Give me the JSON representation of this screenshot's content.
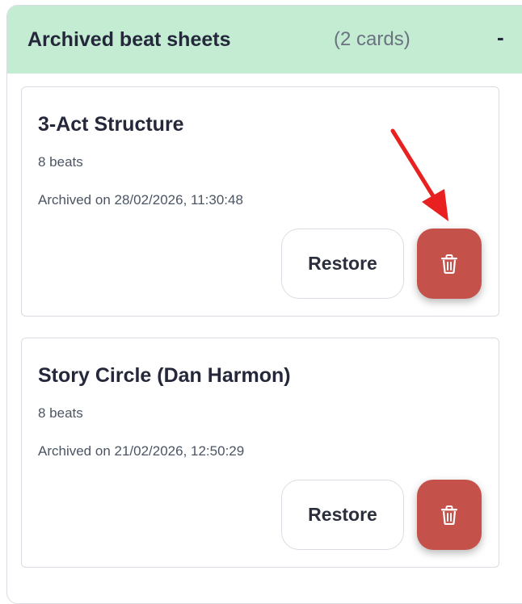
{
  "section": {
    "title": "Archived beat sheets",
    "count": "(2 cards)",
    "toggle": "-"
  },
  "cards": [
    {
      "title": "3-Act Structure",
      "beats": "8 beats",
      "archived": "Archived on 28/02/2026, 11:30:48",
      "restore_label": "Restore",
      "delete_icon": "trash-icon"
    },
    {
      "title": "Story Circle (Dan Harmon)",
      "beats": "8 beats",
      "archived": "Archived on 21/02/2026, 12:50:29",
      "restore_label": "Restore",
      "delete_icon": "trash-icon"
    }
  ],
  "annotation": {
    "arrow_icon": "red-arrow-icon",
    "arrow_color": "#e8201f"
  },
  "colors": {
    "header_bg": "#c3ecd3",
    "delete_bg": "#c4524a"
  }
}
